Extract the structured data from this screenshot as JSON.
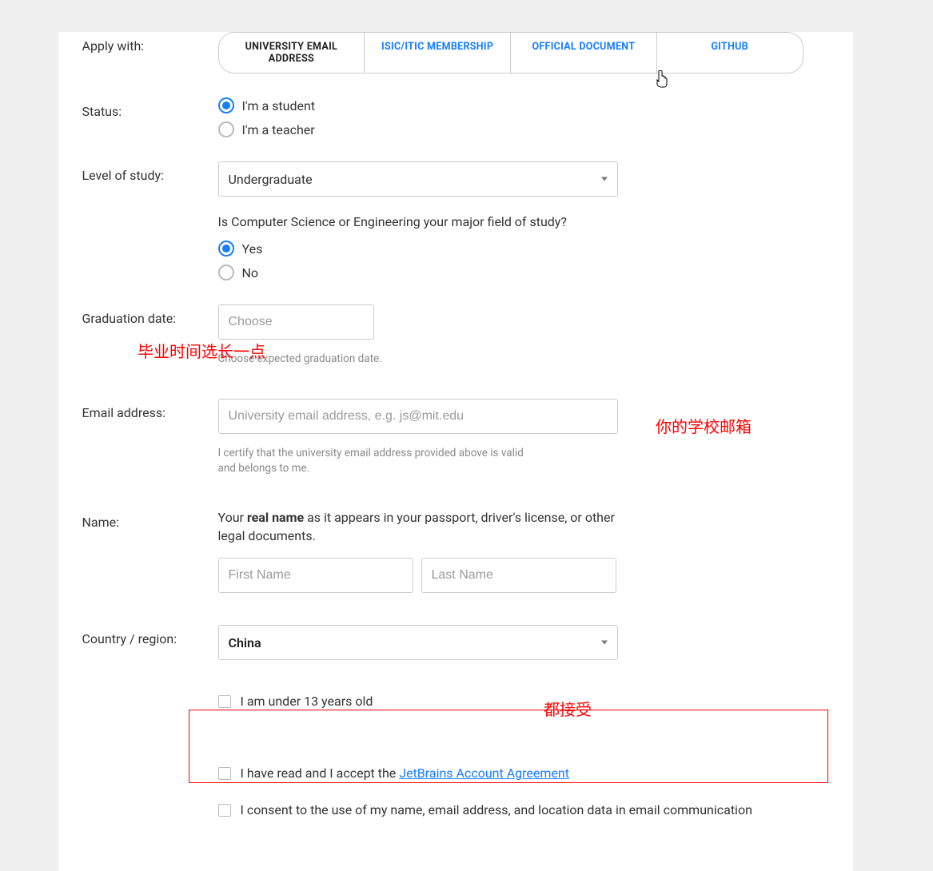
{
  "labels": {
    "apply_with": "Apply with:",
    "status": "Status:",
    "level_of_study": "Level of study:",
    "graduation_date": "Graduation date:",
    "email_address": "Email address:",
    "name": "Name:",
    "country_region": "Country / region:"
  },
  "tabs": {
    "university_email": "UNIVERSITY EMAIL ADDRESS",
    "isic_itic": "ISIC/ITIC MEMBERSHIP",
    "official_document": "OFFICIAL DOCUMENT",
    "github": "GITHUB"
  },
  "status_options": {
    "student": "I'm a student",
    "teacher": "I'm a teacher"
  },
  "level_of_study_value": "Undergraduate",
  "cs_question": "Is Computer Science or Engineering your major field of study?",
  "yesno": {
    "yes": "Yes",
    "no": "No"
  },
  "graduation": {
    "placeholder": "Choose",
    "help": "Choose expected graduation date."
  },
  "email": {
    "placeholder": "University email address, e.g. js@mit.edu",
    "help": "I certify that the university email address provided above is valid and belongs to me."
  },
  "name_block": {
    "prompt_pre": "Your ",
    "prompt_strong": "real name",
    "prompt_post": " as it appears in your passport, driver's license, or other legal documents.",
    "first_placeholder": "First Name",
    "last_placeholder": "Last Name"
  },
  "country_value": "China",
  "checks": {
    "under13": "I am under 13 years old",
    "agree_pre": "I have read and I accept the ",
    "agree_link": "JetBrains Account Agreement",
    "consent": "I consent to the use of my name, email address, and location data in email communication"
  },
  "annotations": {
    "grad_note": "毕业时间选长一点",
    "email_note": "你的学校邮箱",
    "accept_note": "都接受"
  }
}
